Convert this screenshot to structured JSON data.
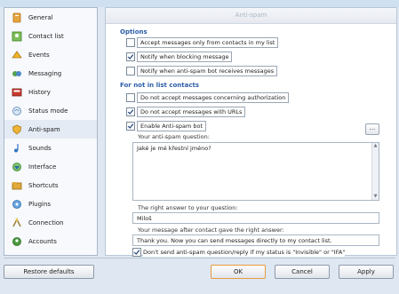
{
  "sidebar": {
    "items": [
      {
        "label": "General",
        "icon": "general-icon",
        "active": false
      },
      {
        "label": "Contact list",
        "icon": "contact-list-icon",
        "active": false
      },
      {
        "label": "Events",
        "icon": "events-icon",
        "active": false
      },
      {
        "label": "Messaging",
        "icon": "messaging-icon",
        "active": false
      },
      {
        "label": "History",
        "icon": "history-icon",
        "active": false
      },
      {
        "label": "Status mode",
        "icon": "status-mode-icon",
        "active": false
      },
      {
        "label": "Anti-spam",
        "icon": "anti-spam-icon",
        "active": true
      },
      {
        "label": "Sounds",
        "icon": "sounds-icon",
        "active": false
      },
      {
        "label": "Interface",
        "icon": "interface-icon",
        "active": false
      },
      {
        "label": "Shortcuts",
        "icon": "shortcuts-icon",
        "active": false
      },
      {
        "label": "Plugins",
        "icon": "plugins-icon",
        "active": false
      },
      {
        "label": "Connection",
        "icon": "connection-icon",
        "active": false
      },
      {
        "label": "Accounts",
        "icon": "accounts-icon",
        "active": false
      }
    ]
  },
  "panel": {
    "title": "Anti-spam",
    "options_title": "Options",
    "options": [
      {
        "label": "Accept messages only from contacts in my list",
        "checked": false
      },
      {
        "label": "Notify when blocking message",
        "checked": true
      },
      {
        "label": "Notify when anti-spam bot receives messages",
        "checked": false
      }
    ],
    "not_in_list_title": "For not in list contacts",
    "not_in_list_options": [
      {
        "label": "Do not accept messages concerning authorization",
        "checked": false
      },
      {
        "label": "Do not accept messages with URLs",
        "checked": true
      },
      {
        "label": "Enable Anti-spam bot",
        "checked": true
      }
    ],
    "ellipsis_label": "...",
    "question_label": "Your anti-spam question:",
    "question_value": "Jaké je mé křestní jméno?",
    "answer_label": "The right answer to your question:",
    "answer_value": "Miloš",
    "after_label": "Your message after contact gave the right answer:",
    "after_value": "Thank you. Now you can send messages directly to my contact list.",
    "dont_send_label": "Don't send anti-spam question/reply if my status is \"Invisible\" or \"IFA\"",
    "dont_send_checked": true
  },
  "buttons": {
    "restore": "Restore defaults",
    "ok": "OK",
    "cancel": "Cancel",
    "apply": "Apply"
  },
  "colors": {
    "section_title": "#2c5da8",
    "default_button_border": "#e89a3c"
  }
}
